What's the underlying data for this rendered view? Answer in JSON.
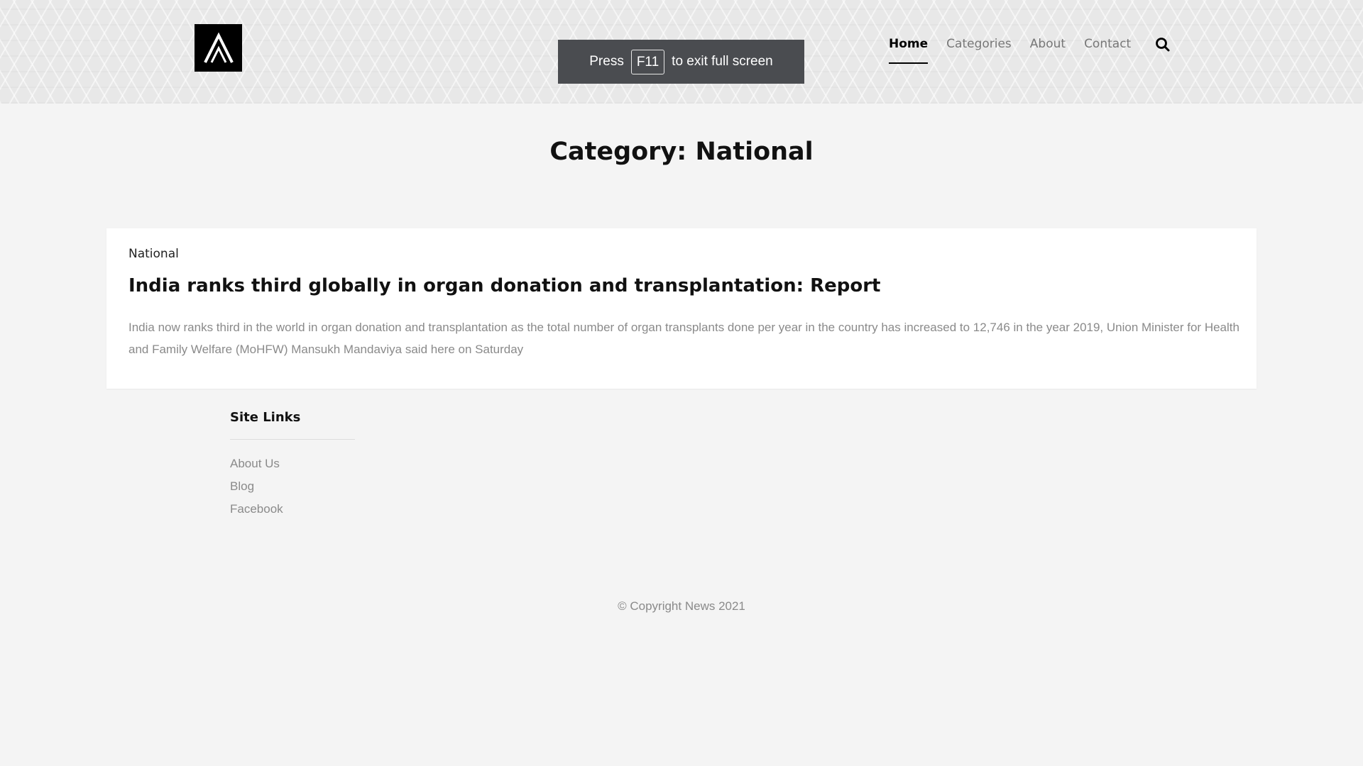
{
  "header": {
    "logo_icon": "stylized-a-logo-icon",
    "nav": [
      {
        "label": "Home",
        "active": true
      },
      {
        "label": "Categories",
        "active": false
      },
      {
        "label": "About",
        "active": false
      },
      {
        "label": "Contact",
        "active": false
      }
    ],
    "search_icon": "search-icon"
  },
  "fullscreen_notice": {
    "prefix": "Press",
    "key": "F11",
    "suffix": "to exit full screen"
  },
  "page": {
    "title": "Category: National"
  },
  "post": {
    "category": "National",
    "title": "India ranks third globally in organ donation and transplantation: Report",
    "excerpt": "India now ranks third in the world in organ donation and transplantation as the total number of organ transplants done per year in the country has increased to 12,746 in the year 2019, Union Minister for Health and Family Welfare (MoHFW) Mansukh Mandaviya said here on Saturday"
  },
  "footer": {
    "heading": "Site Links",
    "links": [
      "About Us",
      "Blog",
      "Facebook"
    ],
    "copyright": "© Copyright News 2021"
  },
  "colors": {
    "background": "#f4f4f4",
    "card": "#ffffff",
    "toast": "#4a4c50",
    "muted_text": "#8a8a8a"
  }
}
